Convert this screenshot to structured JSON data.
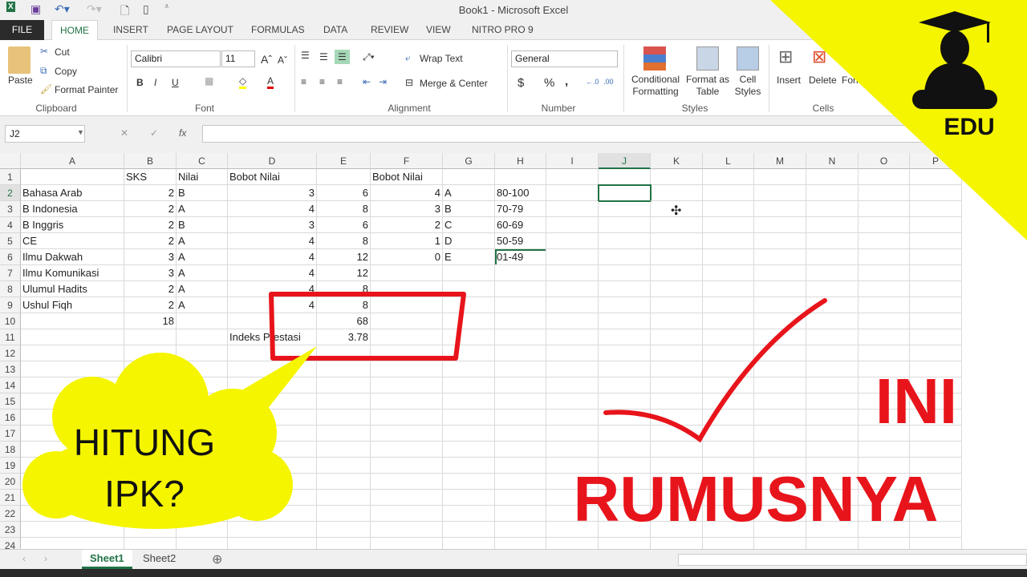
{
  "window": {
    "title": "Book1 - Microsoft Excel"
  },
  "quick_access": {
    "icons": [
      "excel-logo-icon",
      "save-icon",
      "undo-icon",
      "redo-icon",
      "print-preview-icon",
      "new-icon",
      "customize-icon"
    ]
  },
  "tabs": [
    "FILE",
    "HOME",
    "INSERT",
    "PAGE LAYOUT",
    "FORMULAS",
    "DATA",
    "REVIEW",
    "VIEW",
    "NITRO PRO 9"
  ],
  "active_tab": "HOME",
  "ribbon": {
    "clipboard": {
      "paste": "Paste",
      "cut": "Cut",
      "copy": "Copy",
      "format_painter": "Format Painter",
      "label": "Clipboard"
    },
    "font": {
      "name": "Calibri",
      "size": "11",
      "bold": "B",
      "italic": "I",
      "underline": "U",
      "label": "Font"
    },
    "alignment": {
      "wrap": "Wrap Text",
      "merge": "Merge & Center",
      "label": "Alignment"
    },
    "number": {
      "format": "General",
      "currency": "$",
      "percent": "%",
      "comma": ",",
      "label": "Number"
    },
    "styles": {
      "conditional": [
        "Conditional",
        "Formatting"
      ],
      "format_table": [
        "Format as",
        "Table"
      ],
      "cell_styles": [
        "Cell",
        "Styles"
      ],
      "label": "Styles"
    },
    "cells": {
      "insert": "Insert",
      "delete": "Delete",
      "format": "Form",
      "label": "Cells"
    }
  },
  "formula_bar": {
    "name_box": "J2",
    "value": "",
    "fx": "fx",
    "cancel": "✕",
    "enter": "✓"
  },
  "columns": [
    "A",
    "B",
    "C",
    "D",
    "E",
    "F",
    "G",
    "H",
    "I",
    "J",
    "K",
    "L",
    "M",
    "N",
    "O",
    "P"
  ],
  "selected_cell": "J2",
  "rows": [
    [
      "",
      "SKS",
      "Nilai",
      "Bobot Nilai",
      "",
      "Bobot Nilai",
      "",
      ""
    ],
    [
      "Bahasa Arab",
      "2",
      "B",
      "3",
      "6",
      "4",
      "A",
      "80-100"
    ],
    [
      "B Indonesia",
      "2",
      "A",
      "4",
      "8",
      "3",
      "B",
      "70-79"
    ],
    [
      "B Inggris",
      "2",
      "B",
      "3",
      "6",
      "2",
      "C",
      "60-69"
    ],
    [
      "CE",
      "2",
      "A",
      "4",
      "8",
      "1",
      "D",
      "50-59"
    ],
    [
      "Ilmu Dakwah",
      "3",
      "A",
      "4",
      "12",
      "0",
      "E",
      "01-49"
    ],
    [
      "Ilmu Komunikasi",
      "3",
      "A",
      "4",
      "12",
      "",
      "",
      ""
    ],
    [
      "Ulumul Hadits",
      "2",
      "A",
      "4",
      "8",
      "",
      "",
      ""
    ],
    [
      "Ushul Fiqh",
      "2",
      "A",
      "4",
      "8",
      "",
      "",
      ""
    ],
    [
      "",
      "18",
      "",
      "",
      "68",
      "",
      "",
      ""
    ],
    [
      "",
      "",
      "",
      "Indeks Prestasi",
      "3.78",
      "",
      "",
      ""
    ]
  ],
  "sheets": [
    "Sheet1",
    "Sheet2"
  ],
  "active_sheet": "Sheet1",
  "overlay": {
    "bubble_text": [
      "HITUNG",
      "IPK?"
    ],
    "headline": [
      "INI",
      "RUMUSNYA"
    ],
    "logo_text": "EDU",
    "colors": {
      "yellow": "#f5f500",
      "red": "#e8141b",
      "excel_green": "#217346"
    }
  }
}
